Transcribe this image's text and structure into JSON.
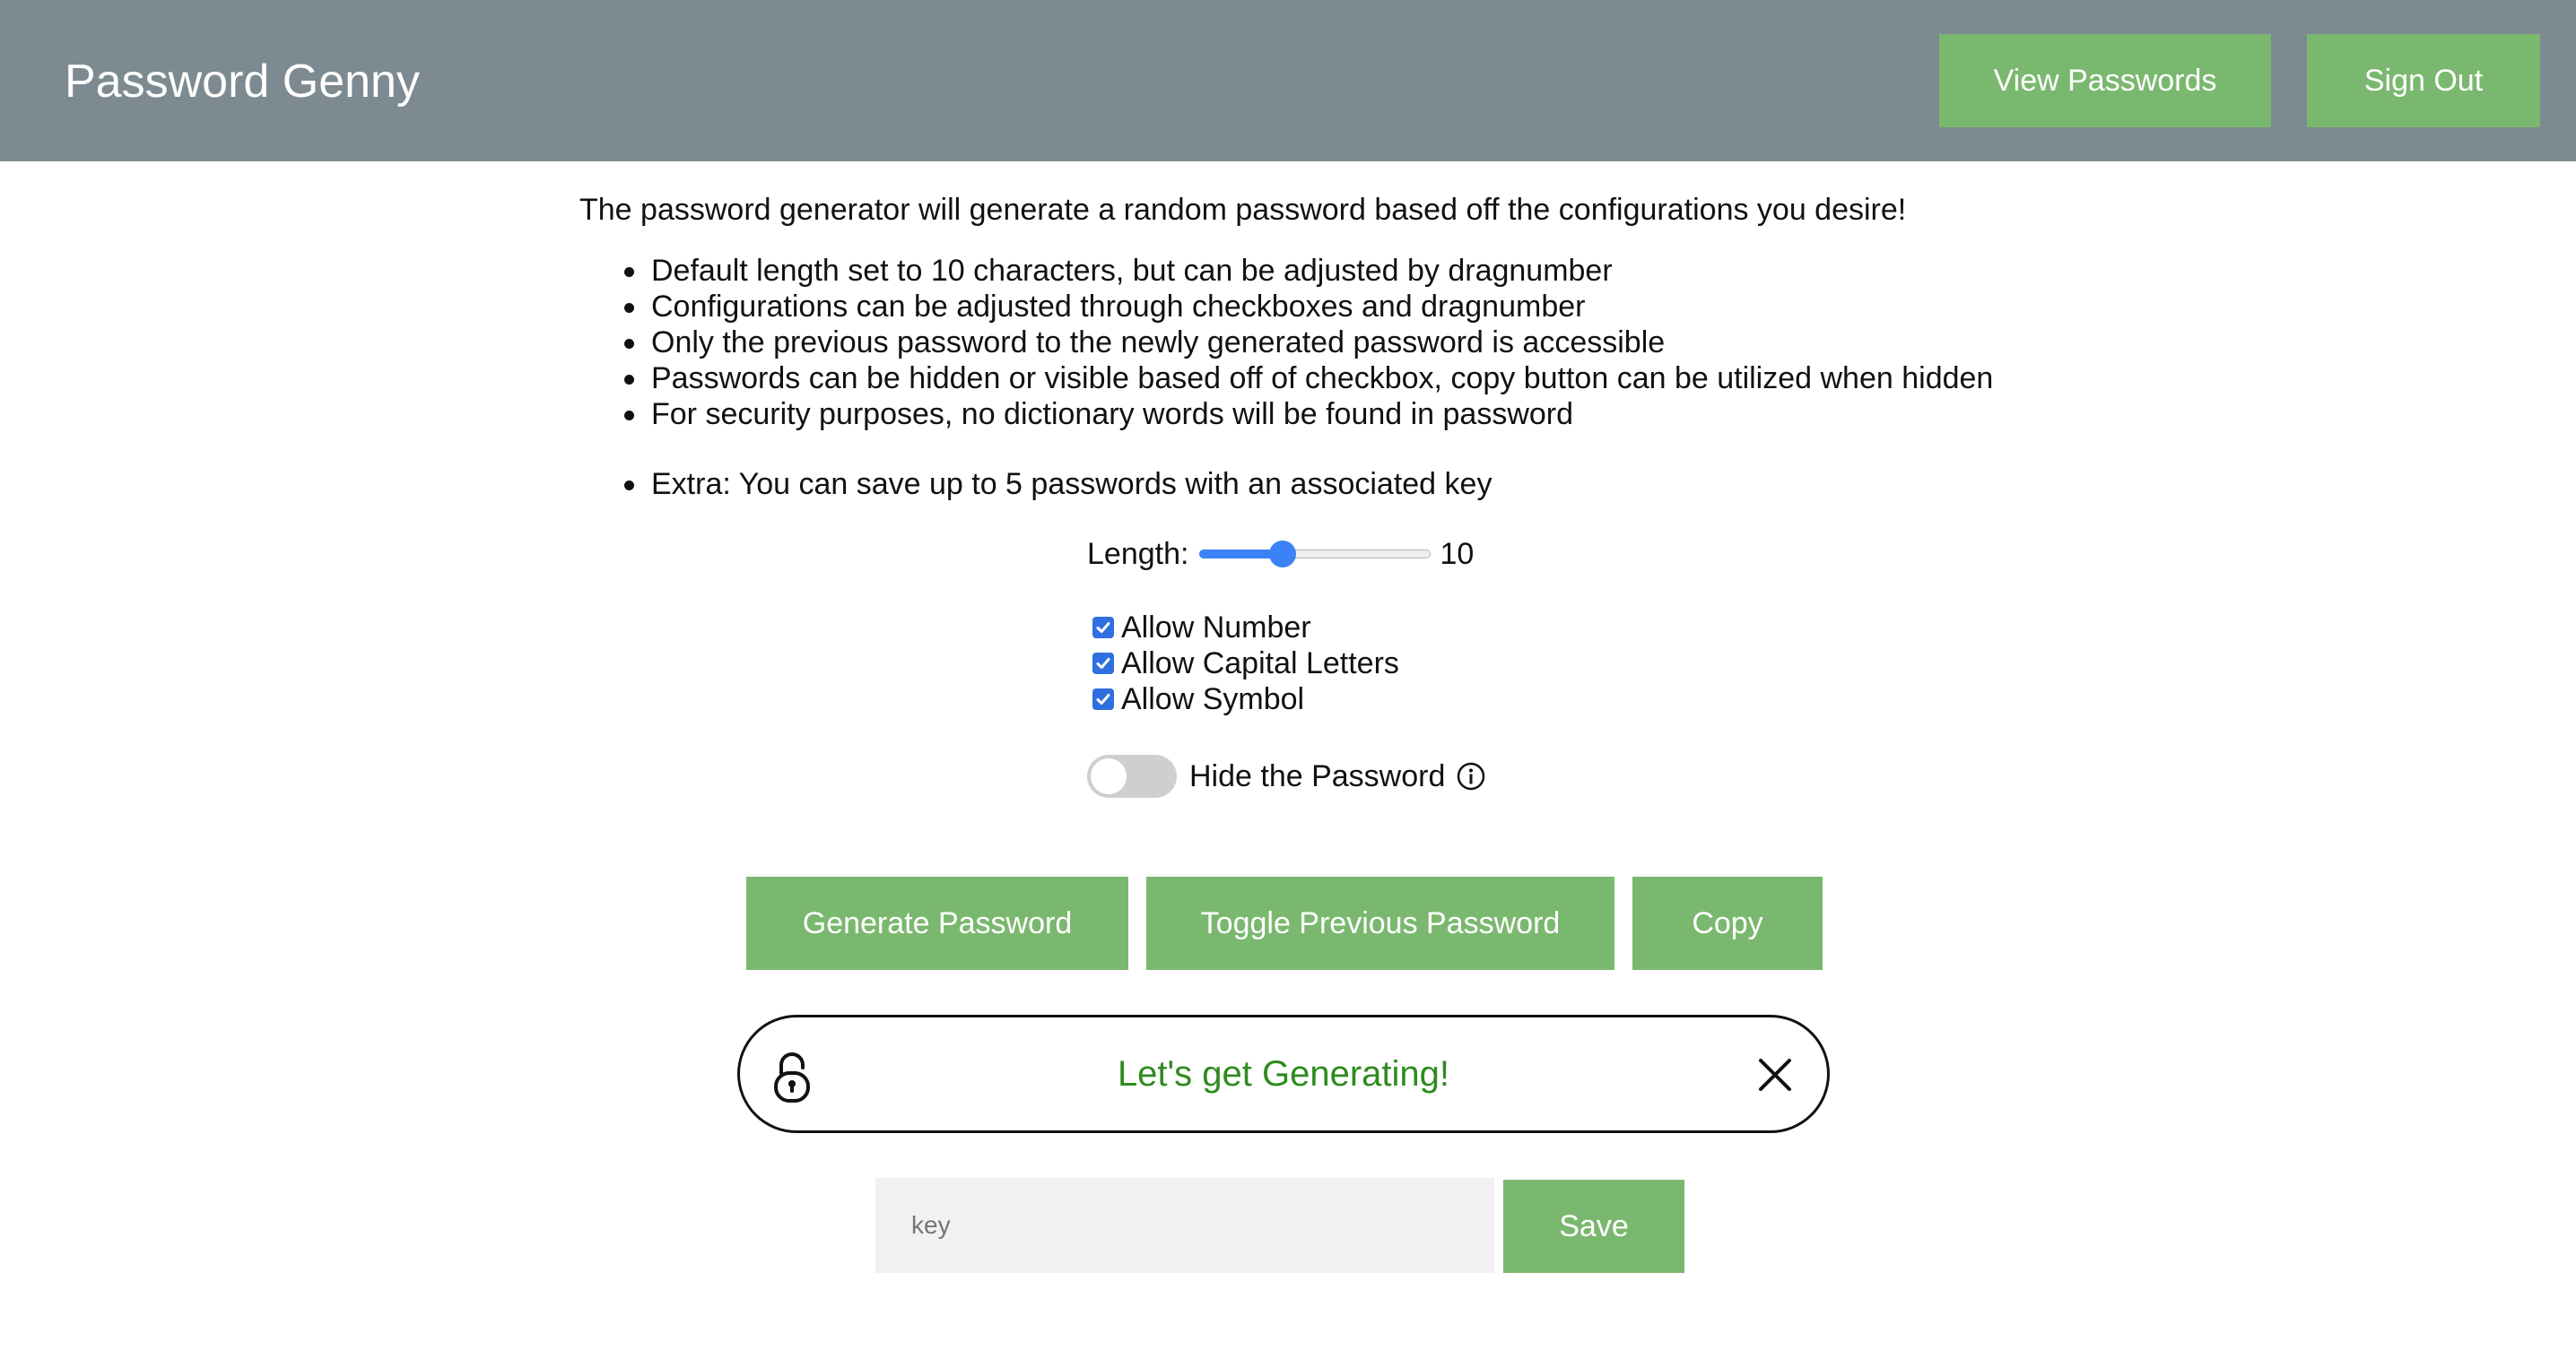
{
  "header": {
    "title": "Password Genny",
    "view_passwords_label": "View Passwords",
    "sign_out_label": "Sign Out"
  },
  "intro": {
    "text": "The password generator will generate a random password based off the configurations you desire!",
    "bullets": [
      "Default length set to 10 characters, but can be adjusted by dragnumber",
      "Configurations can be adjusted through checkboxes and dragnumber",
      "Only the previous password to the newly generated password is accessible",
      "Passwords can be hidden or visible based off of checkbox, copy button can be utilized when hidden",
      "For security purposes, no dictionary words will be found in password"
    ],
    "extra": "Extra: You can save up to 5 passwords with an associated key"
  },
  "length": {
    "label": "Length:",
    "value": "10",
    "slider_fraction": 0.36
  },
  "options": [
    {
      "label": "Allow Number",
      "checked": true
    },
    {
      "label": "Allow Capital Letters",
      "checked": true
    },
    {
      "label": "Allow Symbol",
      "checked": true
    }
  ],
  "hide_toggle": {
    "label": "Hide the Password",
    "on": false
  },
  "actions": {
    "generate_label": "Generate Password",
    "toggle_previous_label": "Toggle Previous Password",
    "copy_label": "Copy"
  },
  "output": {
    "text": "Let's get Generating!",
    "lock_icon": "lock-icon",
    "clear_icon": "close-icon"
  },
  "save": {
    "placeholder": "key",
    "value": "",
    "save_label": "Save"
  },
  "colors": {
    "header_bg": "#7e8a91",
    "button_green": "#7bb86f",
    "output_text": "#2e8b1e",
    "accent_blue": "#3b82f6"
  }
}
